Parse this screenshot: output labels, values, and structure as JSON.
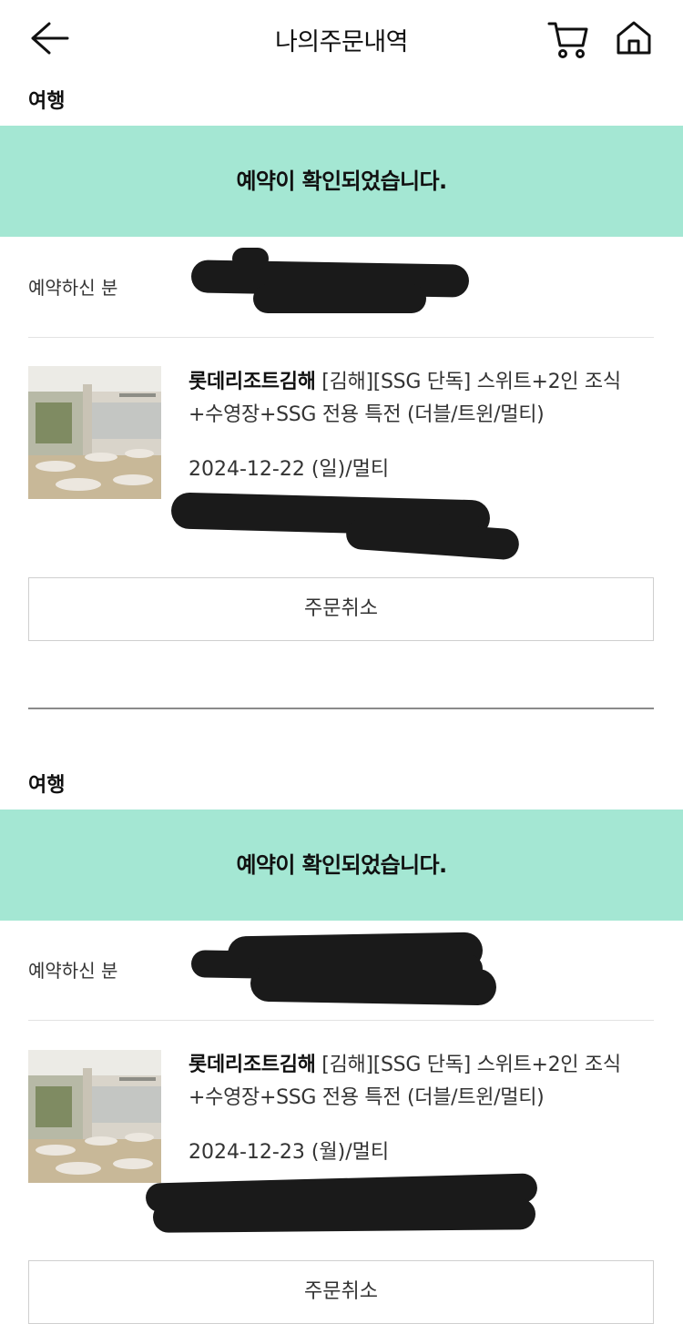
{
  "header": {
    "title": "나의주문내역",
    "back_icon": "arrow-left-icon",
    "cart_icon": "cart-icon",
    "home_icon": "home-icon"
  },
  "orders": [
    {
      "category": "여행",
      "status": "예약이 확인되었습니다.",
      "reserver_label": "예약하신 분",
      "brand": "롯데리조트김해",
      "product_name": " [김해][SSG 단독] 스위트+2인 조식+수영장+SSG 전용 특전 (더블/트윈/멀티)",
      "date_option": "2024-12-22 (일)/멀티",
      "cancel_label": "주문취소"
    },
    {
      "category": "여행",
      "status": "예약이 확인되었습니다.",
      "reserver_label": "예약하신 분",
      "brand": "롯데리조트김해",
      "product_name": " [김해][SSG 단독] 스위트+2인 조식+수영장+SSG 전용 특전 (더블/트윈/멀티)",
      "date_option": "2024-12-23 (월)/멀티",
      "cancel_label": "주문취소"
    }
  ],
  "colors": {
    "banner": "#a4e7d3",
    "redaction": "#1a1a1a"
  }
}
